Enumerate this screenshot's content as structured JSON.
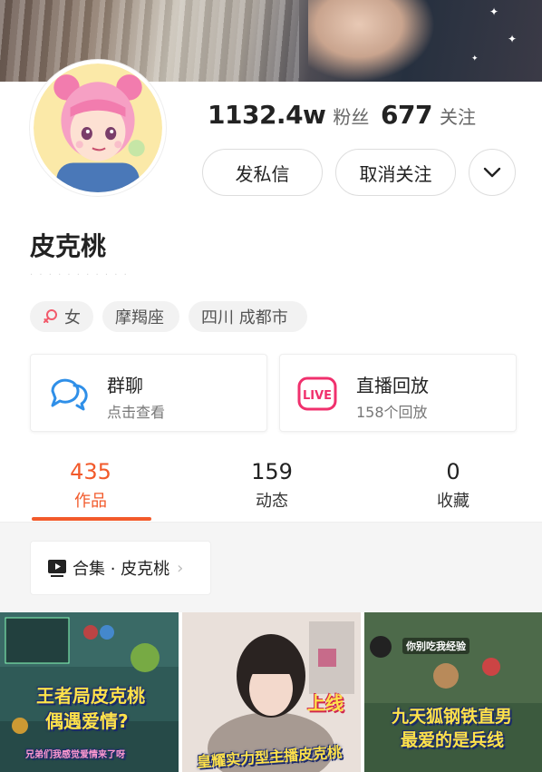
{
  "profile": {
    "name": "皮克桃",
    "followers_value": "1132.4w",
    "followers_label": "粉丝",
    "following_value": "677",
    "following_label": "关注",
    "faint_line": "· · · · · · · · · · ·"
  },
  "actions": {
    "message_label": "发私信",
    "unfollow_label": "取消关注"
  },
  "tags": {
    "gender_icon": "female-icon",
    "gender": "女",
    "zodiac": "摩羯座",
    "location": "四川 成都市"
  },
  "cards": {
    "group_chat": {
      "icon": "chat-bubbles-icon",
      "title": "群聊",
      "sub": "点击查看"
    },
    "live_replay": {
      "icon": "live-icon",
      "icon_text": "LIVE",
      "title": "直播回放",
      "sub": "158个回放"
    }
  },
  "tabs": [
    {
      "count": "435",
      "label": "作品"
    },
    {
      "count": "159",
      "label": "动态"
    },
    {
      "count": "0",
      "label": "收藏"
    }
  ],
  "collection": {
    "label": "合集 · 皮克桃"
  },
  "videos": [
    {
      "line1": "王者局皮克桃",
      "line2": "偶遇爱情?",
      "line3": "兄弟们我感觉爱情来了呀"
    },
    {
      "line1": "上线",
      "line2": "皇耀实力型主播皮克桃"
    },
    {
      "line0": "你别吃我经验",
      "line1": "九天狐钢铁直男",
      "line2": "最爱的是兵线"
    }
  ],
  "colors": {
    "accent": "#f25a2b",
    "live_pink": "#f0306d",
    "chat_blue": "#2f8fe8"
  }
}
